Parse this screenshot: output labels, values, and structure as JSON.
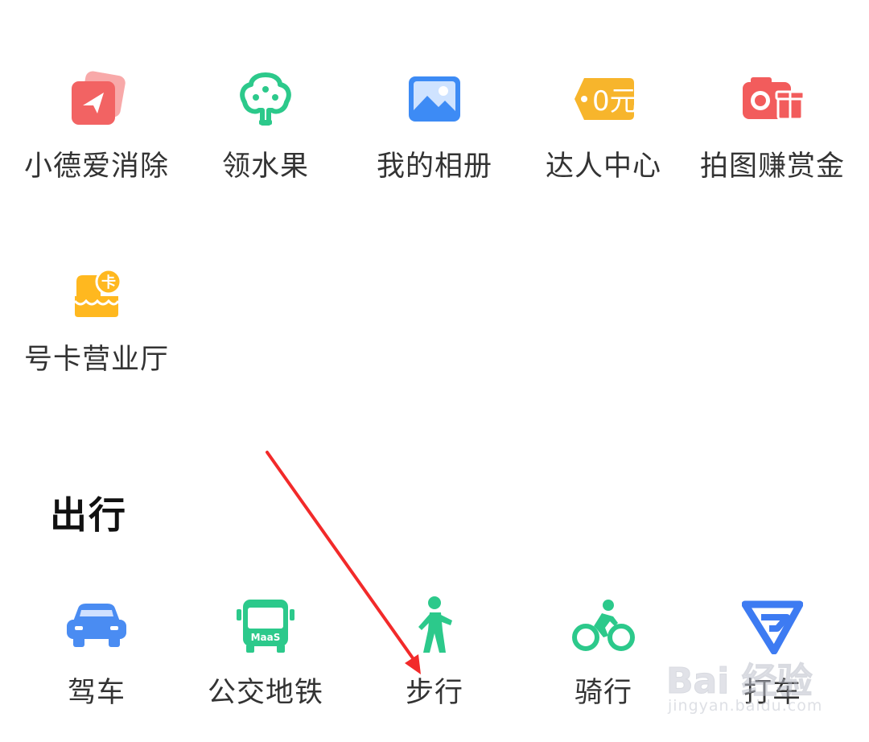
{
  "services": {
    "items": [
      {
        "label": "小德爱消除",
        "icon": "paper-plane-card-icon",
        "color": "#F26363"
      },
      {
        "label": "领水果",
        "icon": "tree-icon",
        "color": "#2CC98B"
      },
      {
        "label": "我的相册",
        "icon": "photo-album-icon",
        "color": "#3D8BF5"
      },
      {
        "label": "达人中心",
        "icon": "price-tag-icon",
        "color": "#F7B52C",
        "tag_text": "0元"
      },
      {
        "label": "拍图赚赏金",
        "icon": "camera-gift-icon",
        "color": "#F25C5C"
      },
      {
        "label": "号卡营业厅",
        "icon": "sim-card-shop-icon",
        "color": "#FFB81F",
        "badge_text": "卡"
      }
    ]
  },
  "travel": {
    "title": "出行",
    "items": [
      {
        "label": "驾车",
        "icon": "car-icon",
        "color": "#4A8CF2"
      },
      {
        "label": "公交地铁",
        "icon": "bus-icon",
        "color": "#2CC98B",
        "bus_text": "MaaS"
      },
      {
        "label": "步行",
        "icon": "walking-person-icon",
        "color": "#2CC98B"
      },
      {
        "label": "骑行",
        "icon": "cycling-icon",
        "color": "#2CC98B"
      },
      {
        "label": "打车",
        "icon": "taxi-logo-icon",
        "color": "#3D7BF2"
      }
    ]
  },
  "annotation": {
    "arrow_color": "#F22A2A"
  },
  "watermark": {
    "logo": "Bai 经验",
    "url": "jingyan.baidu.com"
  }
}
